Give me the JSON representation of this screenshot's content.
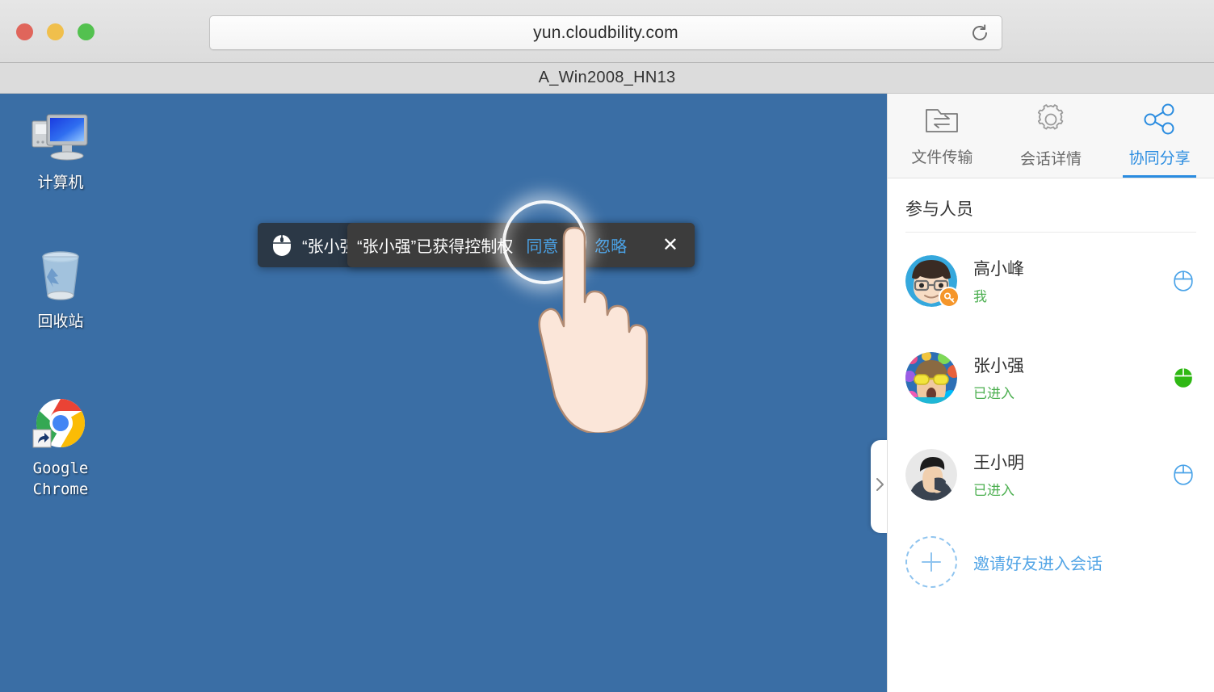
{
  "browser": {
    "url": "yun.cloudbility.com",
    "reload_icon": "reload-icon",
    "traffic_lights": [
      {
        "name": "close",
        "color": "#e0655b"
      },
      {
        "name": "minimize",
        "color": "#f0bf4c"
      },
      {
        "name": "maximize",
        "color": "#53c14f"
      }
    ]
  },
  "session": {
    "title": "A_Win2008_HN13"
  },
  "desktop": {
    "background_color": "#3a6ea5",
    "icons": [
      {
        "label": "计算机",
        "icon": "computer-icon"
      },
      {
        "label": "回收站",
        "icon": "recycle-bin-icon"
      },
      {
        "label": "Google\nChrome",
        "label_line1": "Google",
        "label_line2": "Chrome",
        "icon": "chrome-icon"
      }
    ]
  },
  "toasts": {
    "back": {
      "icon": "mouse-icon",
      "message": "“张小强”失去控制权",
      "background": "#2b3846"
    },
    "front": {
      "icon": "mouse-icon",
      "message": "“张小强”已获得控制权",
      "agree_label": "同意",
      "separator": "✕",
      "ignore_label": "忽略",
      "close_label": "✕",
      "background": "#3c3c3c",
      "action_color": "#4aa3e8"
    }
  },
  "cursor": {
    "type": "pointing-hand-cursor",
    "click_indicator": "click-glow-ring"
  },
  "collapse_handle": {
    "icon": "chevron-right-icon"
  },
  "side_panel": {
    "tabs": [
      {
        "label": "文件传输",
        "icon": "file-transfer-icon",
        "active": false
      },
      {
        "label": "会话详情",
        "icon": "gear-icon",
        "active": false
      },
      {
        "label": "协同分享",
        "icon": "share-icon",
        "active": true
      }
    ],
    "accent_color": "#2a8ce0",
    "heading": "参与人员",
    "participants": [
      {
        "name": "高小峰",
        "status": "我",
        "avatar": "avatar-gao-xiaofeng",
        "badge": "key-badge",
        "control_icon": "mouse-outline-icon",
        "control_state": "inactive"
      },
      {
        "name": "张小强",
        "status": "已进入",
        "avatar": "avatar-zhang-xiaoqiang",
        "badge": null,
        "control_icon": "mouse-filled-icon",
        "control_state": "active"
      },
      {
        "name": "王小明",
        "status": "已进入",
        "avatar": "avatar-wang-xiaoming",
        "badge": null,
        "control_icon": "mouse-outline-icon",
        "control_state": "inactive"
      }
    ],
    "invite": {
      "label": "邀请好友进入会话",
      "icon": "plus-icon"
    }
  }
}
